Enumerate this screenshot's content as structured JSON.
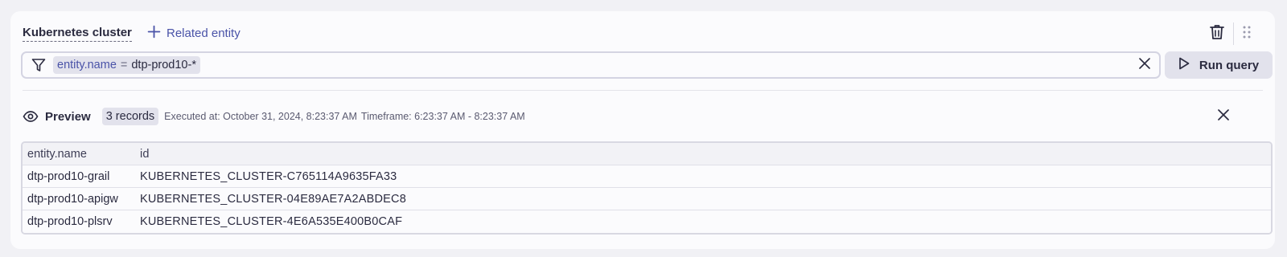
{
  "header": {
    "entity_type": "Kubernetes cluster",
    "related_label": "Related entity"
  },
  "filter": {
    "key": "entity.name",
    "operator": "=",
    "value": "dtp-prod10-*"
  },
  "run_label": "Run query",
  "preview": {
    "label": "Preview",
    "records": "3 records",
    "executed": "Executed at: October 31, 2024, 8:23:37 AM",
    "timeframe": "Timeframe: 6:23:37 AM - 8:23:37 AM"
  },
  "table": {
    "columns": [
      "entity.name",
      "id"
    ],
    "rows": [
      [
        "dtp-prod10-grail",
        "KUBERNETES_CLUSTER-C765114A9635FA33"
      ],
      [
        "dtp-prod10-apigw",
        "KUBERNETES_CLUSTER-04E89AE7A2ABDEC8"
      ],
      [
        "dtp-prod10-plsrv",
        "KUBERNETES_CLUSTER-4E6A535E400B0CAF"
      ]
    ]
  },
  "icons": {
    "plus": "plus-icon",
    "trash": "trash-icon",
    "drag": "drag-handle-icon",
    "filter": "filter-icon",
    "clear": "close-icon",
    "play": "play-icon",
    "eye": "eye-icon",
    "close": "close-icon"
  },
  "colors": {
    "accent": "#4a53a8",
    "chip_bg": "#e2e2ec",
    "card_bg": "#fbfbfd",
    "page_bg": "#f1f1f5"
  }
}
